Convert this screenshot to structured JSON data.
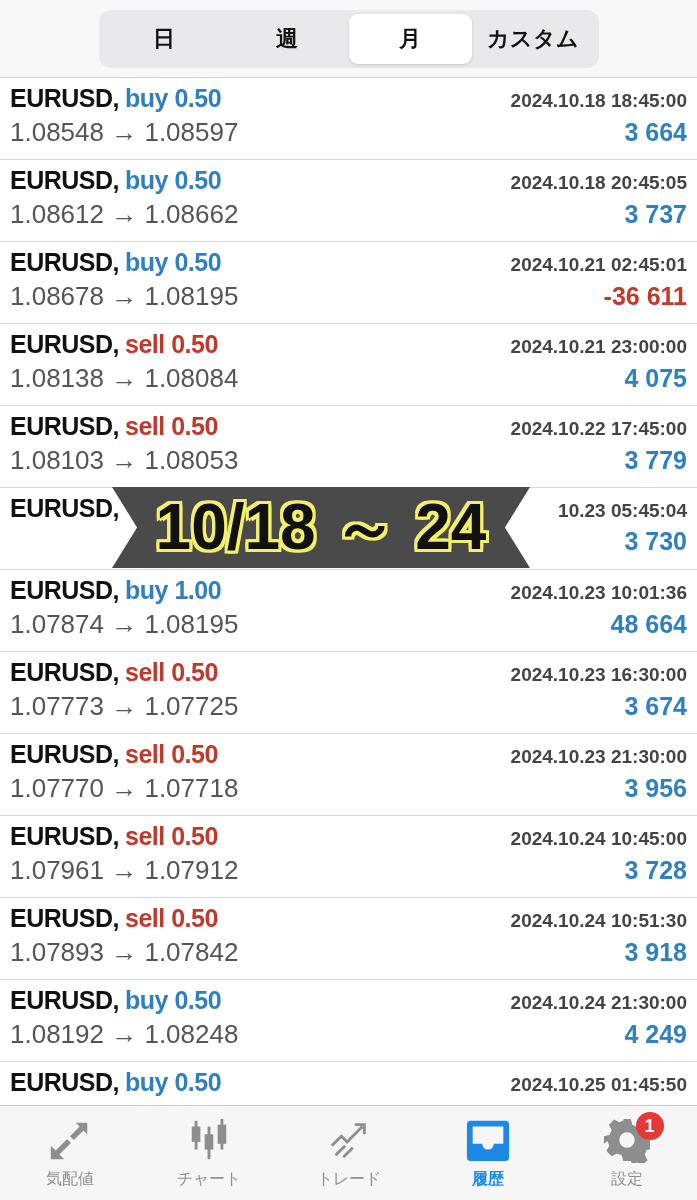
{
  "period_tabs": [
    {
      "label": "日",
      "selected": false
    },
    {
      "label": "週",
      "selected": false
    },
    {
      "label": "月",
      "selected": true
    },
    {
      "label": "カスタム",
      "selected": false
    }
  ],
  "trades": [
    {
      "symbol": "EURUSD,",
      "kind": "buy",
      "order": "buy 0.50",
      "time": "2024.10.18 18:45:00",
      "prices": "1.08548 → 1.08597",
      "profit": "3 664",
      "loss": false
    },
    {
      "symbol": "EURUSD,",
      "kind": "buy",
      "order": "buy 0.50",
      "time": "2024.10.18 20:45:05",
      "prices": "1.08612 → 1.08662",
      "profit": "3 737",
      "loss": false
    },
    {
      "symbol": "EURUSD,",
      "kind": "buy",
      "order": "buy 0.50",
      "time": "2024.10.21 02:45:01",
      "prices": "1.08678 → 1.08195",
      "profit": "-36 611",
      "loss": true
    },
    {
      "symbol": "EURUSD,",
      "kind": "sell",
      "order": "sell 0.50",
      "time": "2024.10.21 23:00:00",
      "prices": "1.08138 → 1.08084",
      "profit": "4 075",
      "loss": false
    },
    {
      "symbol": "EURUSD,",
      "kind": "sell",
      "order": "sell 0.50",
      "time": "2024.10.22 17:45:00",
      "prices": "1.08103 → 1.08053",
      "profit": "3 779",
      "loss": false
    },
    {
      "symbol": "EURUSD,",
      "time": "10.23 05:45:04",
      "profit": "3 730",
      "loss": false
    },
    {
      "symbol": "EURUSD,",
      "kind": "buy",
      "order": "buy 1.00",
      "time": "2024.10.23 10:01:36",
      "prices": "1.07874 → 1.08195",
      "profit": "48 664",
      "loss": false
    },
    {
      "symbol": "EURUSD,",
      "kind": "sell",
      "order": "sell 0.50",
      "time": "2024.10.23 16:30:00",
      "prices": "1.07773 → 1.07725",
      "profit": "3 674",
      "loss": false
    },
    {
      "symbol": "EURUSD,",
      "kind": "sell",
      "order": "sell 0.50",
      "time": "2024.10.23 21:30:00",
      "prices": "1.07770 → 1.07718",
      "profit": "3 956",
      "loss": false
    },
    {
      "symbol": "EURUSD,",
      "kind": "sell",
      "order": "sell 0.50",
      "time": "2024.10.24 10:45:00",
      "prices": "1.07961 → 1.07912",
      "profit": "3 728",
      "loss": false
    },
    {
      "symbol": "EURUSD,",
      "kind": "sell",
      "order": "sell 0.50",
      "time": "2024.10.24 10:51:30",
      "prices": "1.07893 → 1.07842",
      "profit": "3 918",
      "loss": false
    },
    {
      "symbol": "EURUSD,",
      "kind": "buy",
      "order": "buy 0.50",
      "time": "2024.10.24 21:30:00",
      "prices": "1.08192 → 1.08248",
      "profit": "4 249",
      "loss": false
    },
    {
      "symbol": "EURUSD,",
      "kind": "buy",
      "order": "buy 0.50",
      "time": "2024.10.25 01:45:50"
    }
  ],
  "banner": {
    "text": "10/18 ～ 24"
  },
  "bottom_tabs": [
    {
      "label": "気配値",
      "kind": "quotes",
      "selected": false
    },
    {
      "label": "チャート",
      "kind": "chart",
      "selected": false
    },
    {
      "label": "トレード",
      "kind": "trade",
      "selected": false
    },
    {
      "label": "履歴",
      "kind": "history",
      "selected": true
    },
    {
      "label": "設定",
      "kind": "settings",
      "selected": false,
      "badge": "1"
    }
  ]
}
